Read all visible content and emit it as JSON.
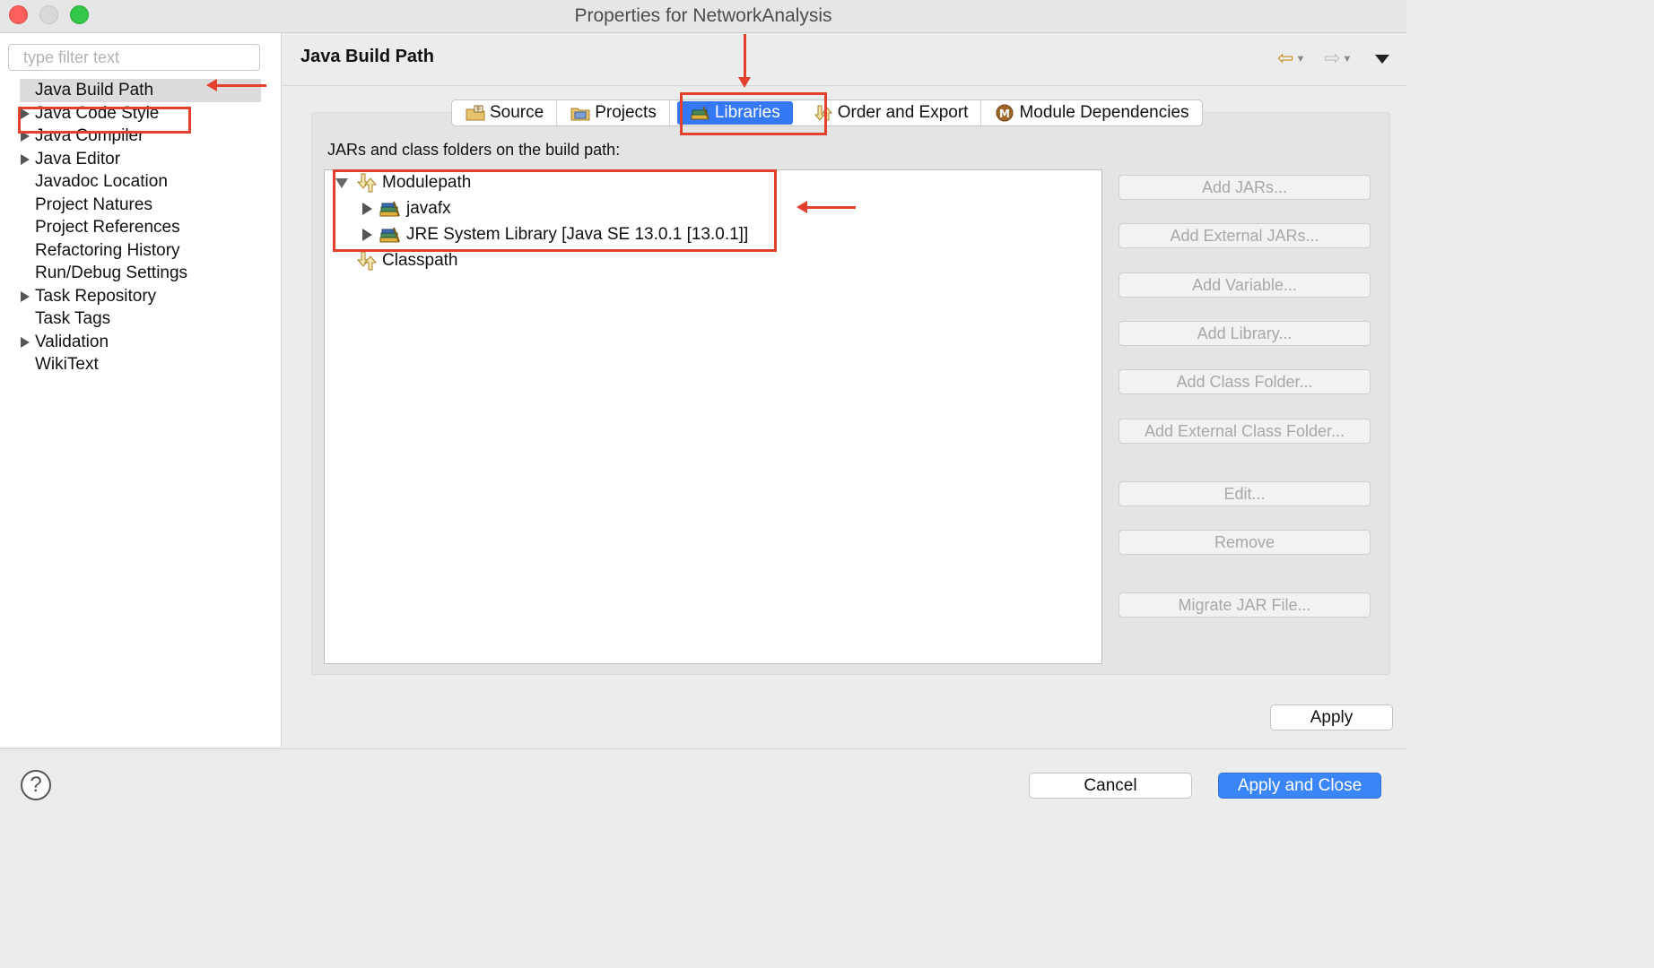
{
  "window": {
    "title": "Properties for NetworkAnalysis"
  },
  "sidebar": {
    "filter_placeholder": "type filter text",
    "items": [
      {
        "label": "Java Build Path",
        "expandable": false,
        "selected": true
      },
      {
        "label": "Java Code Style",
        "expandable": true
      },
      {
        "label": "Java Compiler",
        "expandable": true
      },
      {
        "label": "Java Editor",
        "expandable": true
      },
      {
        "label": "Javadoc Location",
        "expandable": false
      },
      {
        "label": "Project Natures",
        "expandable": false
      },
      {
        "label": "Project References",
        "expandable": false
      },
      {
        "label": "Refactoring History",
        "expandable": false
      },
      {
        "label": "Run/Debug Settings",
        "expandable": false
      },
      {
        "label": "Task Repository",
        "expandable": true
      },
      {
        "label": "Task Tags",
        "expandable": false
      },
      {
        "label": "Validation",
        "expandable": true
      },
      {
        "label": "WikiText",
        "expandable": false
      }
    ]
  },
  "main": {
    "page_title": "Java Build Path",
    "tabs": [
      {
        "label": "Source",
        "icon": "source-folder-icon"
      },
      {
        "label": "Projects",
        "icon": "projects-folder-icon"
      },
      {
        "label": "Libraries",
        "icon": "libraries-icon",
        "active": true
      },
      {
        "label": "Order and Export",
        "icon": "order-export-icon"
      },
      {
        "label": "Module Dependencies",
        "icon": "module-icon"
      }
    ],
    "section_label": "JARs and class folders on the build path:",
    "tree": {
      "modulepath": "Modulepath",
      "javafx": "javafx",
      "jre": "JRE System Library [Java SE 13.0.1 [13.0.1]]",
      "classpath": "Classpath"
    },
    "buttons": {
      "add_jars": "Add JARs...",
      "add_external_jars": "Add External JARs...",
      "add_variable": "Add Variable...",
      "add_library": "Add Library...",
      "add_class_folder": "Add Class Folder...",
      "add_external_class_folder": "Add External Class Folder...",
      "edit": "Edit...",
      "remove": "Remove",
      "migrate_jar": "Migrate JAR File..."
    },
    "apply": "Apply"
  },
  "footer": {
    "cancel": "Cancel",
    "apply_close": "Apply and Close",
    "help": "?"
  },
  "colors": {
    "annotation": "#e4402f",
    "accent": "#3478f6"
  }
}
